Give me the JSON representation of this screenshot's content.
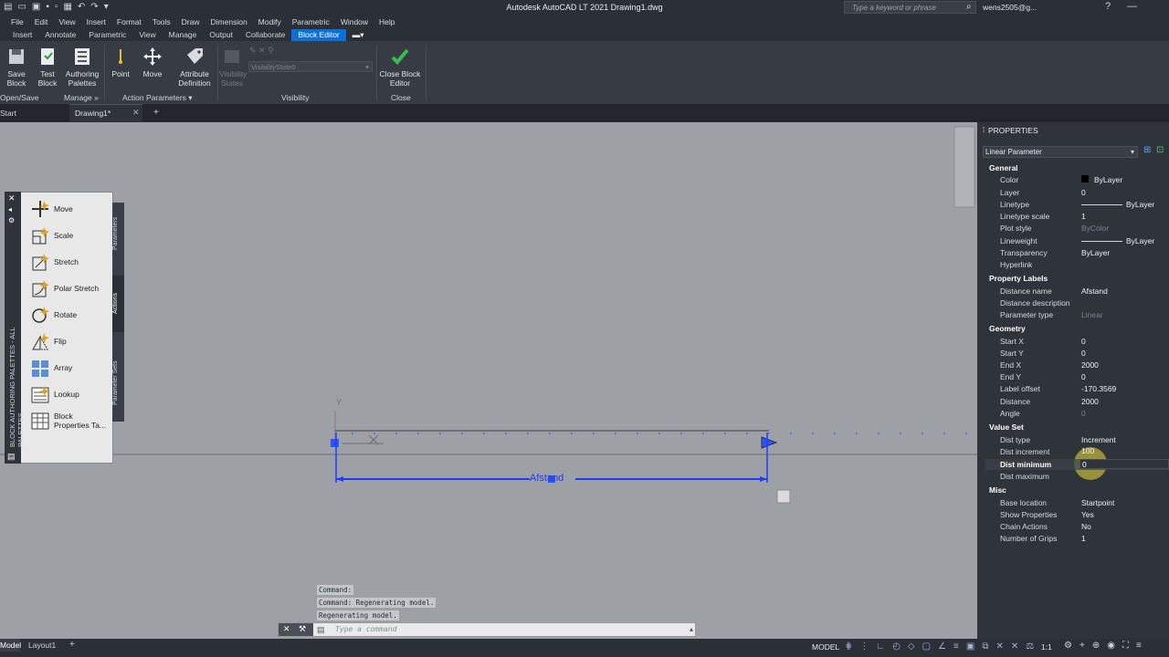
{
  "window": {
    "title": "Autodesk AutoCAD LT 2021   Drawing1.dwg",
    "search_placeholder": "Type a keyword or phrase",
    "user": "wens2505@g...",
    "minimize": "—"
  },
  "menubar": [
    "File",
    "Edit",
    "View",
    "Insert",
    "Format",
    "Tools",
    "Draw",
    "Dimension",
    "Modify",
    "Parametric",
    "Window",
    "Help"
  ],
  "ribbon_tabs": [
    "Insert",
    "Annotate",
    "Parametric",
    "View",
    "Manage",
    "Output",
    "Collaborate",
    "Block Editor"
  ],
  "ribbon": {
    "save_block": "Save Block",
    "test_block": "Test Block",
    "authoring_palettes": "Authoring Palettes",
    "point": "Point",
    "move": "Move",
    "attribute_definition": "Attribute Definition",
    "visibility_states": "Visibility States",
    "visibility_state_value": "VisibilityState0",
    "close_block_editor": "Close Block Editor",
    "panel_open_save": "Open/Save",
    "panel_manage": "Manage »",
    "panel_action_params": "Action Parameters ▾",
    "panel_visibility": "Visibility",
    "panel_close": "Close"
  },
  "file_tabs": {
    "start": "Start",
    "drawing": "Drawing1*",
    "close": "✕",
    "add": "+"
  },
  "palette": {
    "title": "BLOCK AUTHORING PALETTES - ALL PALETTES",
    "tabs": [
      "Parameters",
      "Actions",
      "Parameter Sets"
    ],
    "items": [
      "Move",
      "Scale",
      "Stretch",
      "Polar Stretch",
      "Rotate",
      "Flip",
      "Array",
      "Lookup",
      "Block Properties Ta..."
    ]
  },
  "canvas": {
    "y_axis": "Y",
    "dim_label": "Afstand"
  },
  "command": {
    "history": [
      "Command:",
      "Command: Regenerating model.",
      "Regenerating model."
    ],
    "placeholder": "Type a command"
  },
  "properties": {
    "title": "PROPERTIES",
    "selector": "Linear Parameter",
    "groups": [
      {
        "name": "General",
        "rows": [
          [
            "Color",
            "ByLayer"
          ],
          [
            "Layer",
            "0"
          ],
          [
            "Linetype",
            "ByLayer"
          ],
          [
            "Linetype scale",
            "1"
          ],
          [
            "Plot style",
            "ByColor"
          ],
          [
            "Lineweight",
            "ByLayer"
          ],
          [
            "Transparency",
            "ByLayer"
          ],
          [
            "Hyperlink",
            ""
          ]
        ]
      },
      {
        "name": "Property Labels",
        "rows": [
          [
            "Distance name",
            "Afstand"
          ],
          [
            "Distance description",
            ""
          ],
          [
            "Parameter type",
            "Linear"
          ]
        ]
      },
      {
        "name": "Geometry",
        "rows": [
          [
            "Start X",
            "0"
          ],
          [
            "Start Y",
            "0"
          ],
          [
            "End X",
            "2000"
          ],
          [
            "End Y",
            "0"
          ],
          [
            "Label offset",
            "-170.3569"
          ],
          [
            "Distance",
            "2000"
          ],
          [
            "Angle",
            "0"
          ]
        ]
      },
      {
        "name": "Value Set",
        "rows": [
          [
            "Dist type",
            "Increment"
          ],
          [
            "Dist increment",
            "100"
          ],
          [
            "Dist minimum",
            "0"
          ],
          [
            "Dist maximum",
            ""
          ]
        ]
      },
      {
        "name": "Misc",
        "rows": [
          [
            "Base location",
            "Startpoint"
          ],
          [
            "Show Properties",
            "Yes"
          ],
          [
            "Chain Actions",
            "No"
          ],
          [
            "Number of Grips",
            "1"
          ]
        ]
      }
    ]
  },
  "status": {
    "model_tab": "Model",
    "layout_tab": "Layout1",
    "add": "+",
    "model_btn": "MODEL",
    "scale": "1:1"
  },
  "colors": {
    "accent": "#0a6fd8",
    "parameter": "#1e3cff",
    "canvas": "#9da0a4"
  }
}
